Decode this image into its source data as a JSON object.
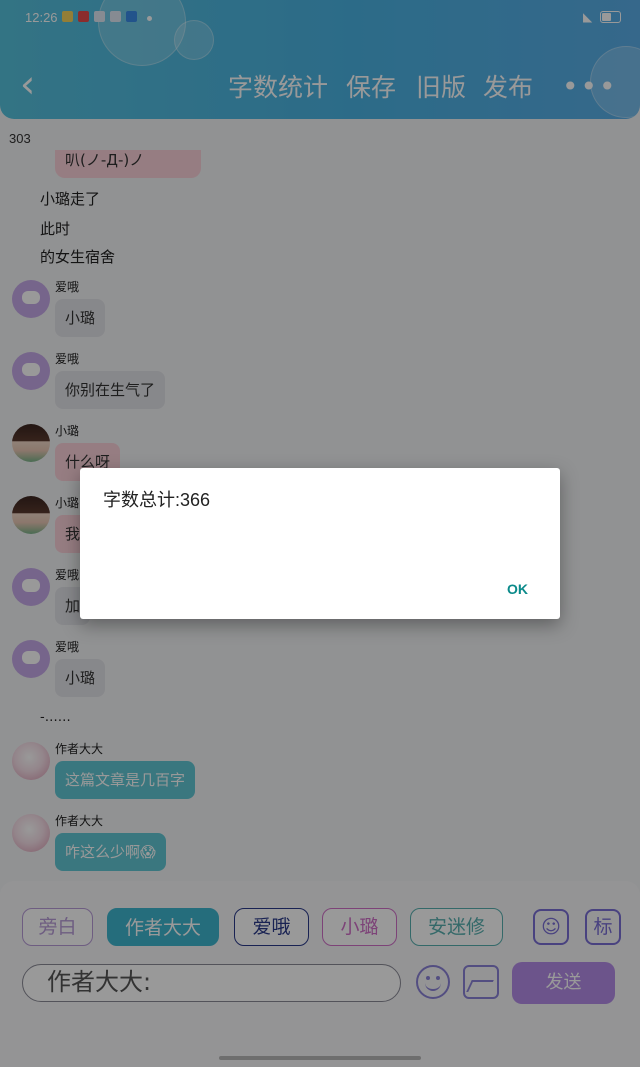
{
  "status_bar": {
    "time": "12:26"
  },
  "header": {
    "back_icon": "chevron-left-icon",
    "actions": [
      "字数统计",
      "保存",
      "旧版",
      "发布"
    ],
    "more_icon": "more-dots-icon"
  },
  "counter": "303",
  "chat": {
    "partial_bubble": "叭(ノ-Д-)ノ",
    "narration": [
      "小璐走了",
      "此时",
      "的女生宿舍"
    ],
    "messages": [
      {
        "sender": "爱哦",
        "text": "小璐"
      },
      {
        "sender": "爱哦",
        "text": "你别在生气了"
      },
      {
        "sender": "小璐",
        "text": "什么呀"
      },
      {
        "sender": "小璐",
        "text": "我"
      },
      {
        "sender": "爱哦",
        "text": "加"
      },
      {
        "sender": "爱哦",
        "text": "小璐"
      }
    ],
    "ellipsis": "-……",
    "author_messages": [
      {
        "sender": "作者大大",
        "text": "这篇文章是几百字"
      },
      {
        "sender": "作者大大",
        "text": "咋这么少啊😱"
      }
    ]
  },
  "input_panel": {
    "roles": [
      "旁白",
      "作者大大",
      "爱哦",
      "小璐",
      "安迷修"
    ],
    "role_colors": [
      "#b79bd8",
      "#3fb6cf",
      "#2a3a8a",
      "#d070c8",
      "#58b0b0"
    ],
    "user_button_icon": "user-icon",
    "mark_button": "标",
    "input_value": "作者大大:",
    "emoji_icon": "smile-icon",
    "image_icon": "image-icon",
    "send_label": "发送"
  },
  "dialog": {
    "message": "字数总计:366",
    "ok_label": "OK"
  }
}
